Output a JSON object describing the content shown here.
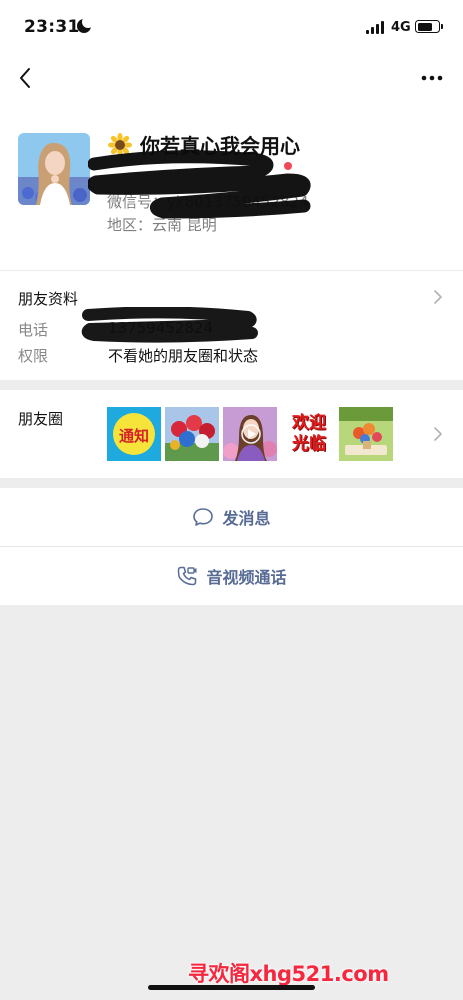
{
  "status_bar": {
    "time": "23:31",
    "network": "4G",
    "battery_level": 0.75
  },
  "profile": {
    "name": "你若真心我会用心",
    "wechat_id": "微信号：yk8013759452824",
    "region": "地区：云南 昆明"
  },
  "info": {
    "section_title": "朋友资料",
    "phone_label": "电话",
    "phone_value": "13759452824",
    "permission_label": "权限",
    "permission_value": "不看她的朋友圈和状态"
  },
  "moments": {
    "label": "朋友圈",
    "thumbnails": [
      {
        "icon": "notice-sign",
        "text": "通知",
        "bg": "#1ea9df"
      },
      {
        "icon": "rose-bouquet"
      },
      {
        "icon": "woman-video"
      },
      {
        "icon": "welcome-sign",
        "text": "欢迎光临"
      },
      {
        "icon": "flower-vase"
      }
    ]
  },
  "actions": {
    "message": "发消息",
    "call": "音视频通话"
  },
  "watermark": "寻欢阁xhg521.com",
  "colors": {
    "link_blue": "#576b95",
    "watermark_red": "#f5283f",
    "background_grey": "#ededed"
  }
}
